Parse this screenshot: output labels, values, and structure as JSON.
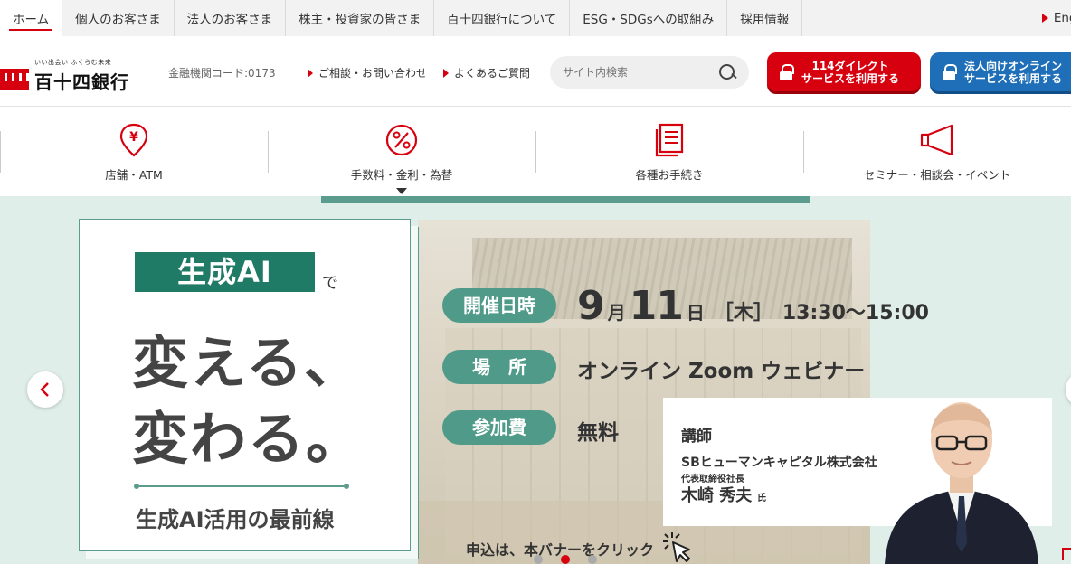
{
  "topnav": {
    "tabs": [
      "ホーム",
      "個人のお客さま",
      "法人のお客さま",
      "株主・投資家の皆さま",
      "百十四銀行について",
      "ESG・SDGsへの取組み",
      "採用情報"
    ],
    "lang": "Engli"
  },
  "header": {
    "tagline": "いい出会い ふくらむ未来",
    "bank_name": "百十四銀行",
    "bank_code": "金融機関コード:0173",
    "link_consult": "ご相談・お問い合わせ",
    "link_faq": "よくあるご質問",
    "search_placeholder": "サイト内検索",
    "cta_direct_l1": "114ダイレクト",
    "cta_direct_l2": "サービスを利用する",
    "cta_corp_l1": "法人向けオンライン",
    "cta_corp_l2": "サービスを利用する"
  },
  "iconnav": {
    "items": [
      "店舗・ATM",
      "手数料・金利・為替",
      "各種お手続き",
      "セミナー・相談会・イベント"
    ]
  },
  "banner": {
    "ai_label": "生成AI",
    "de": "で",
    "line1": "変える、",
    "line2": "変わる。",
    "subtitle": "生成AI活用の最前線",
    "pill_date": "開催日時",
    "month": "9",
    "month_unit": "月",
    "day": "11",
    "day_unit": "日",
    "weekday": "［木］",
    "time": "13:30〜15:00",
    "pill_place": "場　所",
    "place": "オンライン Zoom ウェビナー",
    "pill_fee": "参加費",
    "fee": "無料",
    "speaker_role": "講師",
    "speaker_org": "SBヒューマンキャピタル株式会社",
    "speaker_title": "代表取締役社長",
    "speaker_name": "木崎 秀夫",
    "speaker_suffix": "氏",
    "apply": "申込は、本バナーをクリック"
  },
  "colors": {
    "accent_red": "#d7000f",
    "accent_blue": "#1f6fb8",
    "banner_green": "#4f9a88"
  }
}
